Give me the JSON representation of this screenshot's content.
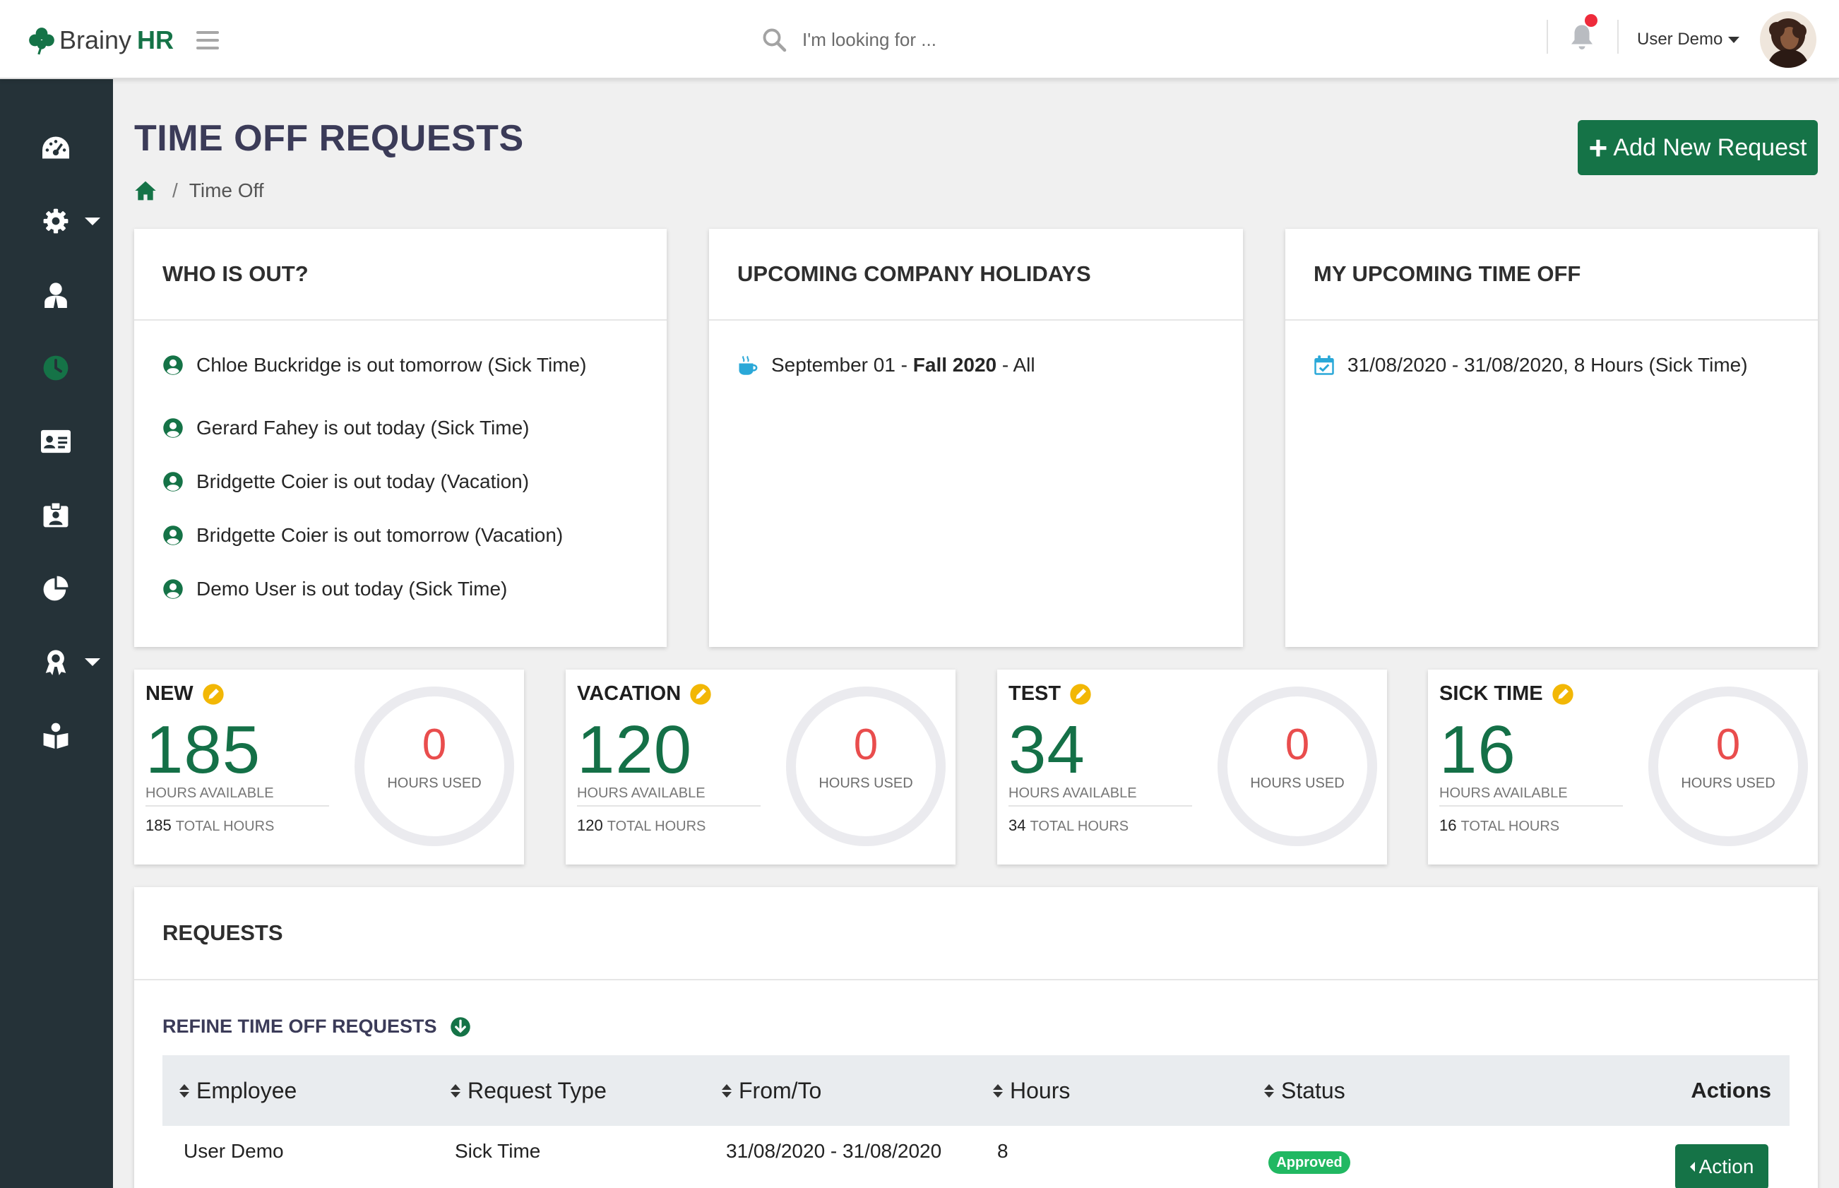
{
  "header": {
    "brand_light": "Brainy",
    "brand_bold": "HR",
    "search_placeholder": "I'm looking for ...",
    "user_name": "User Demo"
  },
  "sidebar": {
    "items": [
      {
        "icon": "dashboard-icon"
      },
      {
        "icon": "gear-icon",
        "has_dropdown": true
      },
      {
        "icon": "employee-icon"
      },
      {
        "icon": "clock-icon",
        "active": true
      },
      {
        "icon": "id-card-icon"
      },
      {
        "icon": "clipboard-badge-icon"
      },
      {
        "icon": "pie-chart-icon"
      },
      {
        "icon": "award-icon",
        "has_dropdown": true
      },
      {
        "icon": "reader-icon"
      }
    ]
  },
  "page": {
    "title": "TIME OFF REQUESTS",
    "breadcrumb": [
      "Time Off"
    ],
    "add_button": "Add New Request"
  },
  "who_is_out": {
    "title": "WHO IS OUT?",
    "items": [
      "Chloe Buckridge is out tomorrow (Sick Time)",
      "Gerard Fahey is out today (Sick Time)",
      "Bridgette Coier is out today (Vacation)",
      "Bridgette Coier is out tomorrow (Vacation)",
      "Demo User is out today (Sick Time)"
    ]
  },
  "holidays": {
    "title": "UPCOMING COMPANY HOLIDAYS",
    "items": [
      {
        "date": "September 01",
        "sep1": " - ",
        "name": "Fall 2020",
        "sep2": " - ",
        "scope": "All"
      }
    ]
  },
  "my_time_off": {
    "title": "MY UPCOMING TIME OFF",
    "items": [
      "31/08/2020 - 31/08/2020, 8 Hours (Sick Time)"
    ]
  },
  "balances": [
    {
      "name": "NEW",
      "available": "185",
      "available_label": "HOURS AVAILABLE",
      "total": "185",
      "total_label": "TOTAL HOURS",
      "used": "0",
      "used_label": "HOURS USED"
    },
    {
      "name": "VACATION",
      "available": "120",
      "available_label": "HOURS AVAILABLE",
      "total": "120",
      "total_label": "TOTAL HOURS",
      "used": "0",
      "used_label": "HOURS USED"
    },
    {
      "name": "TEST",
      "available": "34",
      "available_label": "HOURS AVAILABLE",
      "total": "34",
      "total_label": "TOTAL HOURS",
      "used": "0",
      "used_label": "HOURS USED"
    },
    {
      "name": "SICK TIME",
      "available": "16",
      "available_label": "HOURS AVAILABLE",
      "total": "16",
      "total_label": "TOTAL HOURS",
      "used": "0",
      "used_label": "HOURS USED"
    }
  ],
  "requests": {
    "title": "REQUESTS",
    "refine_label": "REFINE TIME OFF REQUESTS",
    "columns": {
      "employee": "Employee",
      "type": "Request Type",
      "range": "From/To",
      "hours": "Hours",
      "status": "Status",
      "actions": "Actions"
    },
    "rows": [
      {
        "employee": "User Demo",
        "type": "Sick Time",
        "range": "31/08/2020 - 31/08/2020",
        "hours": "8",
        "status": "Approved",
        "action": "Action"
      }
    ]
  },
  "colors": {
    "brand_green": "#157347",
    "sidebar": "#253238",
    "title": "#3b3b58",
    "used_red": "#e94d4d",
    "edit_yellow": "#f2b705",
    "status_green": "#21b862",
    "info_blue": "#2aa8d8"
  }
}
